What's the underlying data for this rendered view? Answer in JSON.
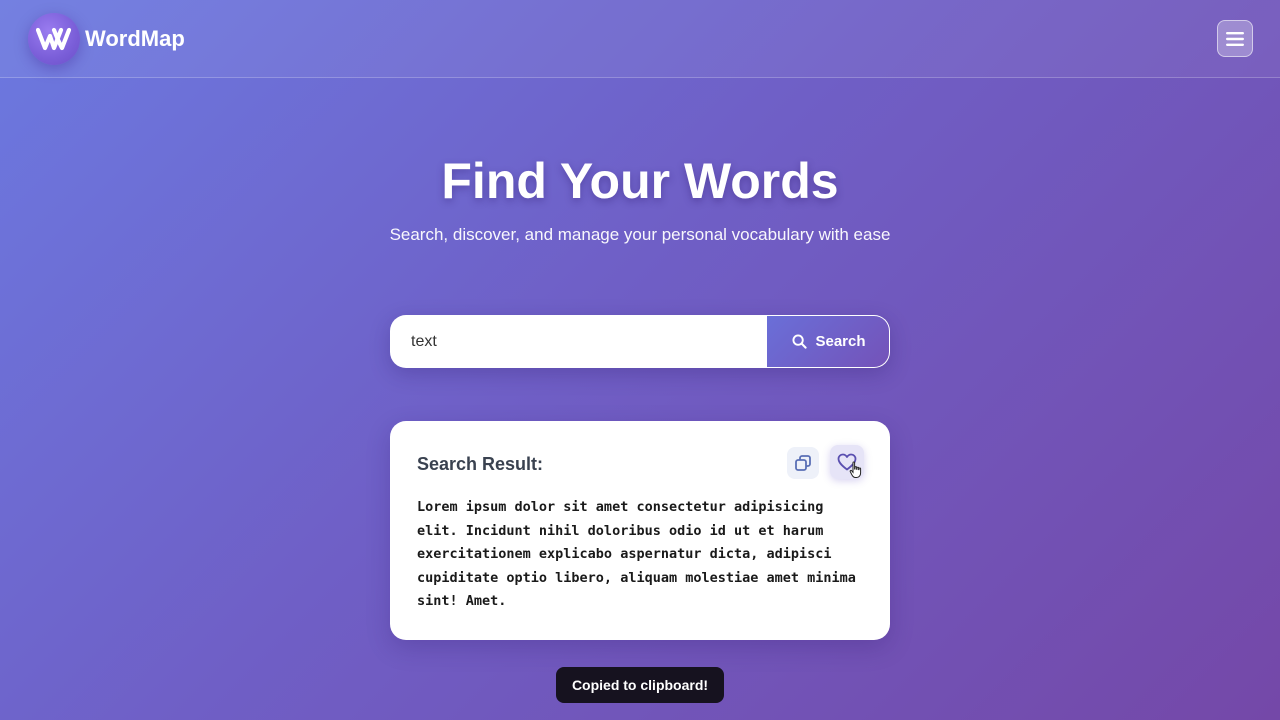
{
  "brand": {
    "name": "WordMap",
    "logo_icon": "w-logo-icon"
  },
  "nav": {
    "menu_icon": "hamburger-menu-icon"
  },
  "hero": {
    "title": "Find Your Words",
    "subtitle": "Search, discover, and manage your personal vocabulary with ease"
  },
  "search": {
    "value": "text",
    "button_label": "Search",
    "button_icon": "search-icon"
  },
  "result": {
    "title": "Search Result:",
    "copy_icon": "copy-icon",
    "favorite_icon": "heart-icon",
    "text": "Lorem ipsum dolor sit amet consectetur adipisicing elit. Incidunt nihil doloribus odio id ut et harum exercitationem explicabo aspernatur dicta, adipisci cupiditate optio libero, aliquam molestiae amet minima sint! Amet."
  },
  "toast": {
    "message": "Copied to clipboard!"
  },
  "colors": {
    "gradient_start": "#6c79e0",
    "gradient_end": "#7448a8",
    "toast_bg": "#16121f",
    "card_bg": "#ffffff"
  }
}
